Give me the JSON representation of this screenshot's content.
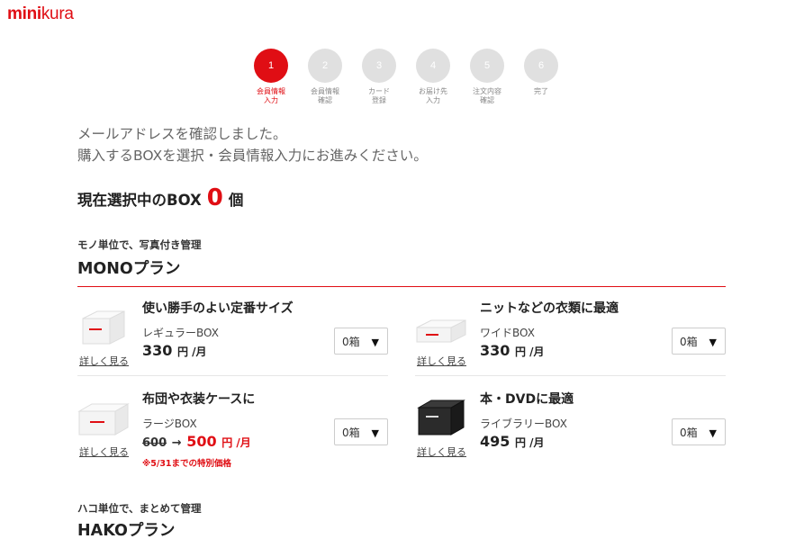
{
  "logo": {
    "bold": "mini",
    "light": "kura"
  },
  "steps": [
    {
      "num": "1",
      "label": "会員情報\n入力"
    },
    {
      "num": "2",
      "label": "会員情報\n確認"
    },
    {
      "num": "3",
      "label": "カード\n登録"
    },
    {
      "num": "4",
      "label": "お届け先\n入力"
    },
    {
      "num": "5",
      "label": "注文内容\n確認"
    },
    {
      "num": "6",
      "label": "完了"
    }
  ],
  "intro": {
    "line1": "メールアドレスを確認しました。",
    "line2": "購入するBOXを選択・会員情報入力にお進みください。"
  },
  "selected": {
    "label": "現在選択中のBOX",
    "count": "0",
    "unit": "個"
  },
  "mono": {
    "subtitle": "モノ単位で、写真付き管理",
    "title": "MONOプラン",
    "items": [
      {
        "title": "使い勝手のよい定番サイズ",
        "name": "レギュラーBOX",
        "price": "330",
        "unit": "円 /月",
        "more": "詳しく見る",
        "select": "0箱"
      },
      {
        "title": "ニットなどの衣類に最適",
        "name": "ワイドBOX",
        "price": "330",
        "unit": "円 /月",
        "more": "詳しく見る",
        "select": "0箱"
      },
      {
        "title": "布団や衣装ケースに",
        "name": "ラージBOX",
        "old_price": "600",
        "arrow": "→",
        "price": "500",
        "unit": "円 /月",
        "note": "※5/31までの特別価格",
        "more": "詳しく見る",
        "select": "0箱"
      },
      {
        "title": "本・DVDに最適",
        "name": "ライブラリーBOX",
        "price": "495",
        "unit": "円 /月",
        "more": "詳しく見る",
        "select": "0箱"
      }
    ]
  },
  "hako": {
    "subtitle": "ハコ単位で、まとめて管理",
    "title": "HAKOプラン"
  },
  "icons": {
    "caret": "caret-down-icon"
  },
  "colors": {
    "accent": "#e00e14",
    "step_inactive": "#e0e0e0"
  }
}
